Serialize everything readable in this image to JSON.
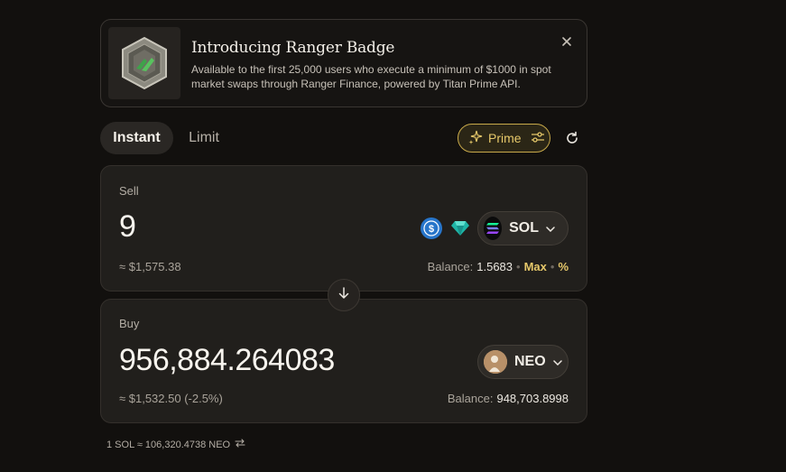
{
  "banner": {
    "title": "Introducing Ranger Badge",
    "text": "Available to the first 25,000 users who execute a minimum of $1000 in spot market swaps through Ranger Finance, powered by Titan Prime API."
  },
  "tabs": [
    {
      "label": "Instant",
      "active": true
    },
    {
      "label": "Limit",
      "active": false
    }
  ],
  "prime": {
    "label": "Prime"
  },
  "sell": {
    "label": "Sell",
    "amount": "9",
    "usd": "≈ $1,575.38",
    "token": "SOL",
    "balance_label": "Balance:",
    "balance_value": "1.5683",
    "max_label": "Max",
    "percent_label": "%"
  },
  "buy": {
    "label": "Buy",
    "amount": "956,884.264083",
    "usd": "≈ $1,532.50 (-2.5%)",
    "token": "NEO",
    "balance_label": "Balance:",
    "balance_value": "948,703.8998"
  },
  "rate": {
    "text": "1 SOL ≈ 106,320.4738 NEO"
  },
  "colors": {
    "accent": "#e6c86a",
    "background": "#12100e",
    "card": "#211f1c"
  },
  "icons": [
    "badge-image",
    "close-icon",
    "sparkle-icon",
    "filter-icon",
    "refresh-icon",
    "usdc-icon",
    "gem-icon",
    "sol-icon",
    "chevron-down-icon",
    "arrow-down-icon",
    "neo-icon",
    "swap-icon"
  ]
}
